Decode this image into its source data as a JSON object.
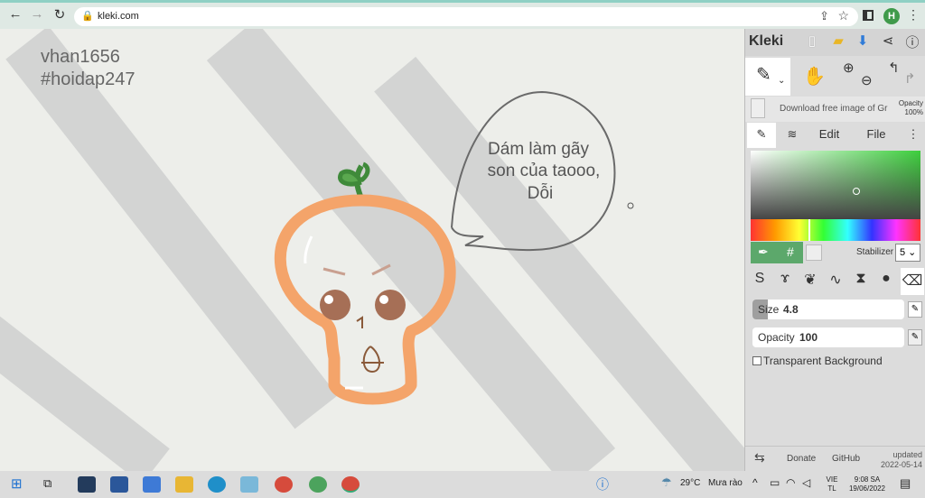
{
  "browser": {
    "url": "kleki.com",
    "avatar_letter": "H"
  },
  "canvas": {
    "watermark_lines": [
      "vhan1656",
      "#hoidap247"
    ],
    "speech_bubble_lines": [
      "Dám làm gãy",
      "son của taooo,",
      "Dỗi"
    ]
  },
  "panel": {
    "brand": "Kleki",
    "image_label": "Download free image of Gr",
    "opacity_label": "Opacity",
    "opacity_value": "100%",
    "tabs": {
      "edit": "Edit",
      "file": "File"
    },
    "stabilizer_label": "Stabilizer",
    "stabilizer_value": "5",
    "size_label": "Size",
    "size_value": "4.8",
    "size_fraction": 0.1,
    "opacity_slider_label": "Opacity",
    "opacity_slider_value": "100",
    "transparent_label": "Transparent Background",
    "footer": {
      "donate": "Donate",
      "github": "GitHub",
      "updated_label": "updated",
      "updated_date": "2022-05-14"
    }
  },
  "taskbar": {
    "weather": "29°C",
    "weather_desc": "Mưa rào",
    "lang_top": "VIE",
    "lang_bottom": "TL",
    "time": "9:08 SA",
    "date": "19/06/2022"
  },
  "colors": {
    "accent_green": "#5ca86b",
    "orange_stroke": "#f4a46a",
    "leaf": "#3f8a3a"
  }
}
